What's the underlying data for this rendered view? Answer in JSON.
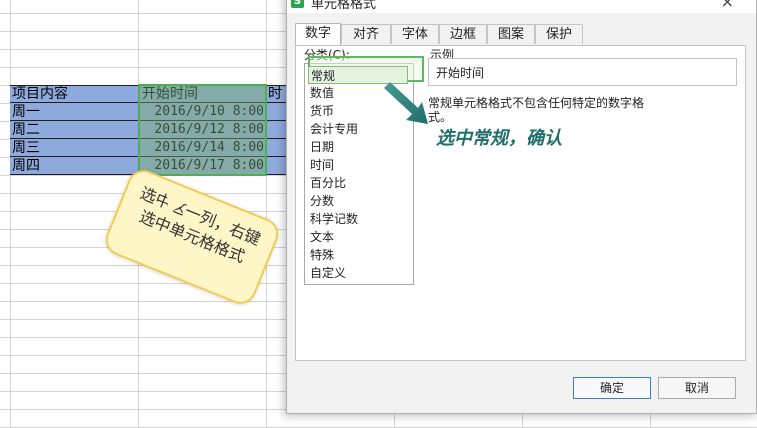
{
  "sheet": {
    "header": {
      "item": "项目内容",
      "start_time": "开始时间",
      "next_col": "时"
    },
    "rows": [
      {
        "item": "周一",
        "time": "2016/9/10  8:00"
      },
      {
        "item": "周二",
        "time": "2016/9/12  8:00"
      },
      {
        "item": "周三",
        "time": "2016/9/14  8:00"
      },
      {
        "item": "周四",
        "time": "2016/9/17  8:00"
      }
    ],
    "callout": "选中这一列，右键选中单元格格式"
  },
  "dialog": {
    "title": "单元格格式",
    "close_glyph": "×",
    "tabs": [
      "数字",
      "对齐",
      "字体",
      "边框",
      "图案",
      "保护"
    ],
    "active_tab": "数字",
    "category_label": "分类(C):",
    "categories": [
      "常规",
      "数值",
      "货币",
      "会计专用",
      "日期",
      "时间",
      "百分比",
      "分数",
      "科学记数",
      "文本",
      "特殊",
      "自定义"
    ],
    "selected_category": "常规",
    "sample_label": "示例",
    "sample_value": "开始时间",
    "description": "常规单元格格式不包含任何特定的数字格式。",
    "annotation": "选中常规，确认",
    "ok_label": "确定",
    "cancel_label": "取消"
  },
  "colors": {
    "table_fill": "#8ea9db",
    "selection_border": "#4caf50",
    "annotation_text": "#1f6f6a",
    "arrow": "#1f6f6a",
    "callout_fill": "#fff6c8",
    "callout_border": "#f3cc55"
  },
  "icons": {
    "dialog": "spreadsheet-app-icon",
    "close": "close-icon",
    "arrow": "arrow-icon"
  }
}
